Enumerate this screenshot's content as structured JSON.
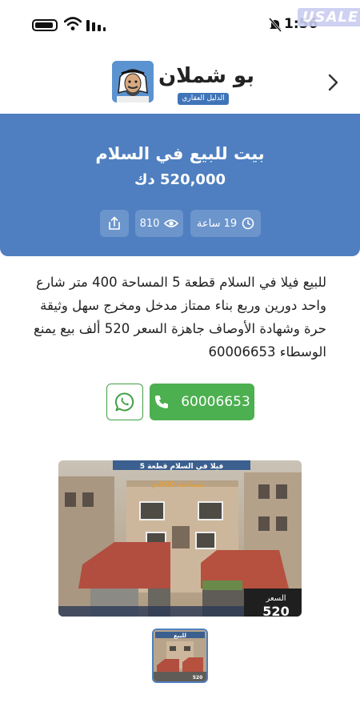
{
  "status_bar": {
    "time": "1:56",
    "watermark": "USALE"
  },
  "header": {
    "logo_title": "بو شملان",
    "logo_subtitle": "الدليل العقاري"
  },
  "listing": {
    "title": "بيت للبيع في السلام",
    "price": "520,000 دك",
    "time_ago": "19 ساعة",
    "views": "810",
    "description": "للبيع فيلا في السلام قطعة 5 المساحة 400 متر شارع واحد دورين وربع بناء ممتاز مدخل ومخرج سهل وثيقة حرة وشهادة الأوصاف جاهزة السعر 520 ألف بيع يمنع الوسطاء 60006653"
  },
  "actions": {
    "phone": "60006653"
  },
  "photo": {
    "banner_text": "فيلا في السلام قطعة 5",
    "area_text": "مساحة 400م",
    "price_label": "السعر",
    "price_value": "520",
    "thumb_label": "للبيع"
  }
}
